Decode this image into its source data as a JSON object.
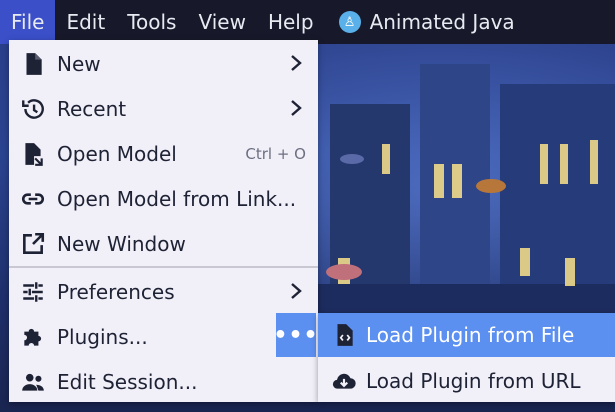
{
  "menubar": {
    "items": [
      {
        "label": "File",
        "active": true
      },
      {
        "label": "Edit"
      },
      {
        "label": "Tools"
      },
      {
        "label": "View"
      },
      {
        "label": "Help"
      }
    ],
    "plugin": {
      "label": "Animated Java",
      "icon": "animated-java-icon"
    }
  },
  "file_menu": {
    "items": [
      {
        "label": "New",
        "icon": "file-icon",
        "submenu": true
      },
      {
        "label": "Recent",
        "icon": "history-icon",
        "submenu": true
      },
      {
        "label": "Open Model",
        "icon": "open-file-icon",
        "shortcut": "Ctrl + O"
      },
      {
        "label": "Open Model from Link...",
        "icon": "link-icon"
      },
      {
        "label": "New Window",
        "icon": "open-in-new-icon"
      },
      {
        "label": "Preferences",
        "icon": "tune-icon",
        "submenu": true
      },
      {
        "label": "Plugins...",
        "icon": "puzzle-icon"
      },
      {
        "label": "Edit Session...",
        "icon": "people-icon"
      }
    ]
  },
  "plugins_submenu": {
    "toggle_label": "•••",
    "items": [
      {
        "label": "Load Plugin from File",
        "icon": "code-file-icon",
        "highlighted": true
      },
      {
        "label": "Load Plugin from URL",
        "icon": "cloud-download-icon"
      }
    ]
  },
  "colors": {
    "menubar_bg": "#17192a",
    "active_menu": "#3a4fc8",
    "highlight": "#5b8ff0",
    "menu_bg": "#f1eff7"
  }
}
